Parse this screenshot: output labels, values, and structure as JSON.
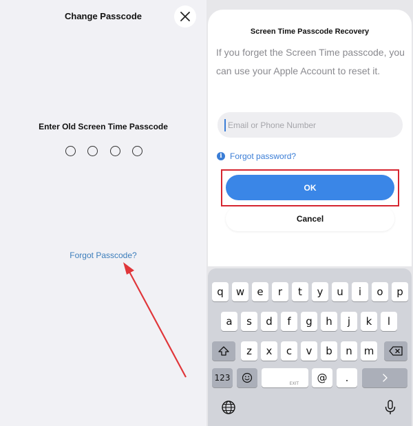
{
  "left": {
    "title": "Change Passcode",
    "prompt": "Enter Old Screen Time Passcode",
    "passcode_length": 4,
    "forgot_link": "Forgot Passcode?",
    "close_icon": "close-icon"
  },
  "right": {
    "sheet_title": "Screen Time Passcode Recovery",
    "description": "If you forget the Screen Time passcode, you can use your Apple Account to reset it.",
    "email_field": {
      "placeholder": "Email or Phone Number",
      "value": ""
    },
    "forgot_password": "Forgot password?",
    "info_icon": "info-icon",
    "ok_label": "OK",
    "cancel_label": "Cancel",
    "keyboard": {
      "row1": [
        "q",
        "w",
        "e",
        "r",
        "t",
        "y",
        "u",
        "i",
        "o",
        "p"
      ],
      "row2": [
        "a",
        "s",
        "d",
        "f",
        "g",
        "h",
        "j",
        "k",
        "l"
      ],
      "row3": [
        "z",
        "x",
        "c",
        "v",
        "b",
        "n",
        "m"
      ],
      "numbers_label": "123",
      "at_label": "@",
      "dot_label": ".",
      "space_sublabel": "EXIT"
    }
  },
  "colors": {
    "accent": "#3a86e7",
    "link": "#3b7dbb",
    "highlight": "#d6252f",
    "arrow": "#e0363a"
  }
}
